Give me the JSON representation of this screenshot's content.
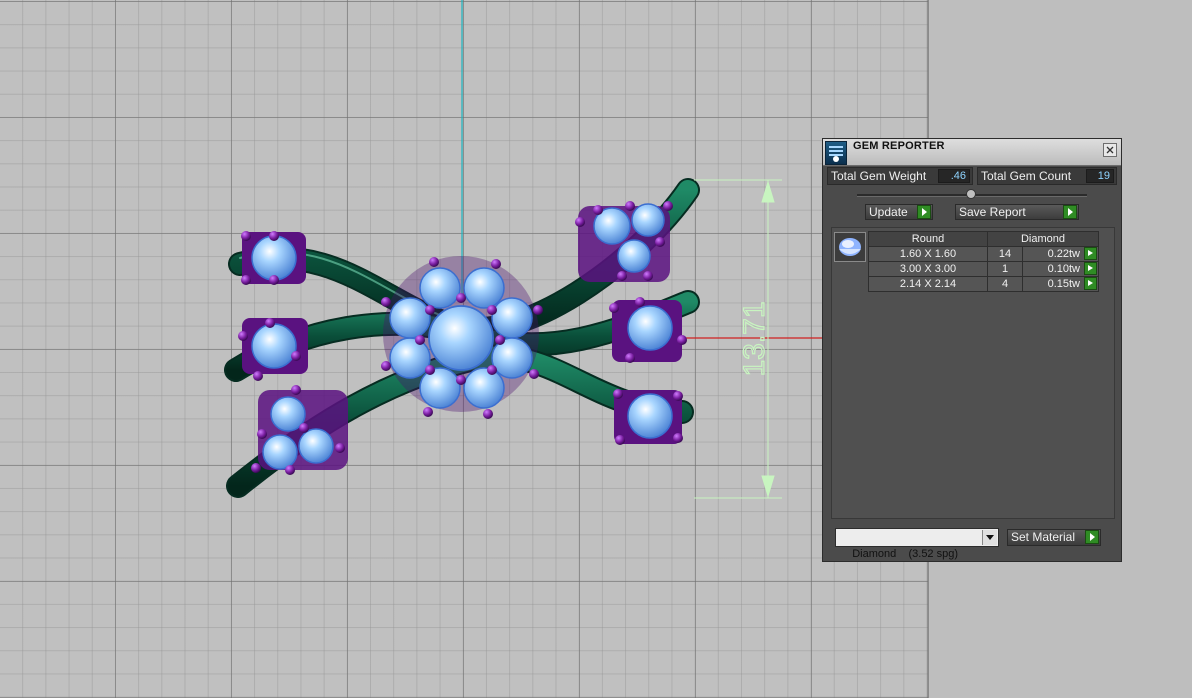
{
  "viewport": {
    "dimension_value": "13.71",
    "colors": {
      "grid_background": "#c0c0c0",
      "shank": "#0c5a44",
      "gem": "#9fd0ff",
      "prong": "#7b1fa2",
      "dimension_line": "#c8f5c0",
      "axis_x": "#d02020",
      "axis_y": "#1bb7c2"
    }
  },
  "gem_reporter": {
    "title": "GEM REPORTER",
    "total_weight_label": "Total Gem Weight",
    "total_weight_value": ".46",
    "total_count_label": "Total Gem Count",
    "total_count_value": "19",
    "update_label": "Update",
    "save_report_label": "Save Report",
    "table": {
      "headers": [
        "Round",
        "Diamond"
      ],
      "rows": [
        {
          "size": "1.60 X 1.60",
          "count": "14",
          "weight": "0.22tw"
        },
        {
          "size": "3.00 X 3.00",
          "count": "1",
          "weight": "0.10tw"
        },
        {
          "size": "2.14 X 2.14",
          "count": "4",
          "weight": "0.15tw"
        }
      ]
    },
    "material_select_value": "Diamond    (3.52 spg)",
    "set_material_label": "Set Material"
  }
}
